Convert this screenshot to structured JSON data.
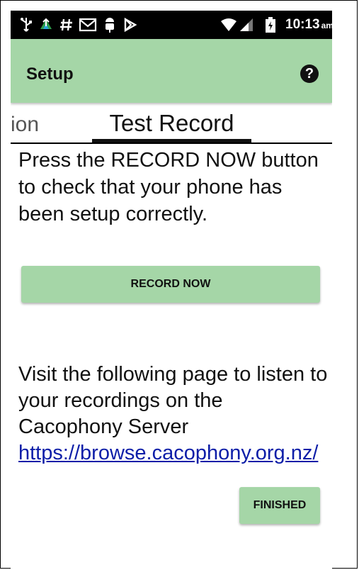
{
  "status_bar": {
    "time": "10:13",
    "ampm": "am",
    "icons": [
      "usb-icon",
      "upload-cloud-icon",
      "hash-icon",
      "gmail-icon",
      "android-debug-icon",
      "play-icon",
      "wifi-icon",
      "signal-icon",
      "battery-icon"
    ]
  },
  "app_bar": {
    "title": "Setup",
    "help_icon": "?"
  },
  "tabs": {
    "previous_partial": "ion",
    "active": "Test Record"
  },
  "content": {
    "instructions": "Press the RECORD NOW button to check that your phone has been setup correctly.",
    "record_button": "RECORD NOW",
    "visit_text": "Visit the following page to listen to your recordings on the Cacophony Server ",
    "link_text": "https://browse.cacophony.org.nz/",
    "finished_button": "FINISHED"
  },
  "colors": {
    "accent": "#a5d6a7",
    "link": "#0d1ea8",
    "status_bar": "#000000"
  }
}
